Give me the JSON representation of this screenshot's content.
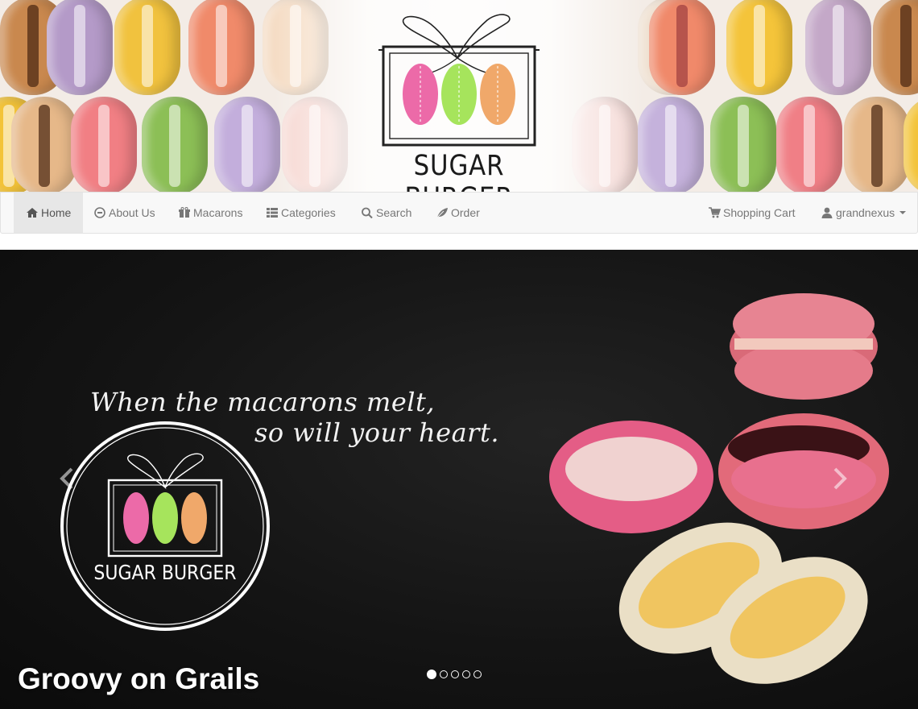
{
  "brand": {
    "name": "SUGAR BURGER"
  },
  "nav": {
    "items": [
      {
        "label": "Home",
        "icon": "home-icon",
        "active": true
      },
      {
        "label": "About Us",
        "icon": "circle-info-icon",
        "active": false
      },
      {
        "label": "Macarons",
        "icon": "gift-icon",
        "active": false
      },
      {
        "label": "Categories",
        "icon": "list-icon",
        "active": false
      },
      {
        "label": "Search",
        "icon": "search-icon",
        "active": false
      },
      {
        "label": "Order",
        "icon": "leaf-icon",
        "active": false
      }
    ],
    "right": [
      {
        "label": "Shopping Cart",
        "icon": "cart-icon"
      },
      {
        "label": "grandnexus",
        "icon": "user-icon",
        "dropdown": true
      }
    ]
  },
  "carousel": {
    "slogan_line1": "When the macarons melt,",
    "slogan_line2": "so will your heart.",
    "logo_text": "SUGAR BURGER",
    "caption": "Groovy on Grails",
    "slide_count": 5,
    "active_slide": 1
  },
  "colors": {
    "pink": "#ec6aa8",
    "green": "#a6e45c",
    "orange": "#f0a86a",
    "navbar_bg": "#f8f8f8",
    "nav_text": "#777777"
  }
}
